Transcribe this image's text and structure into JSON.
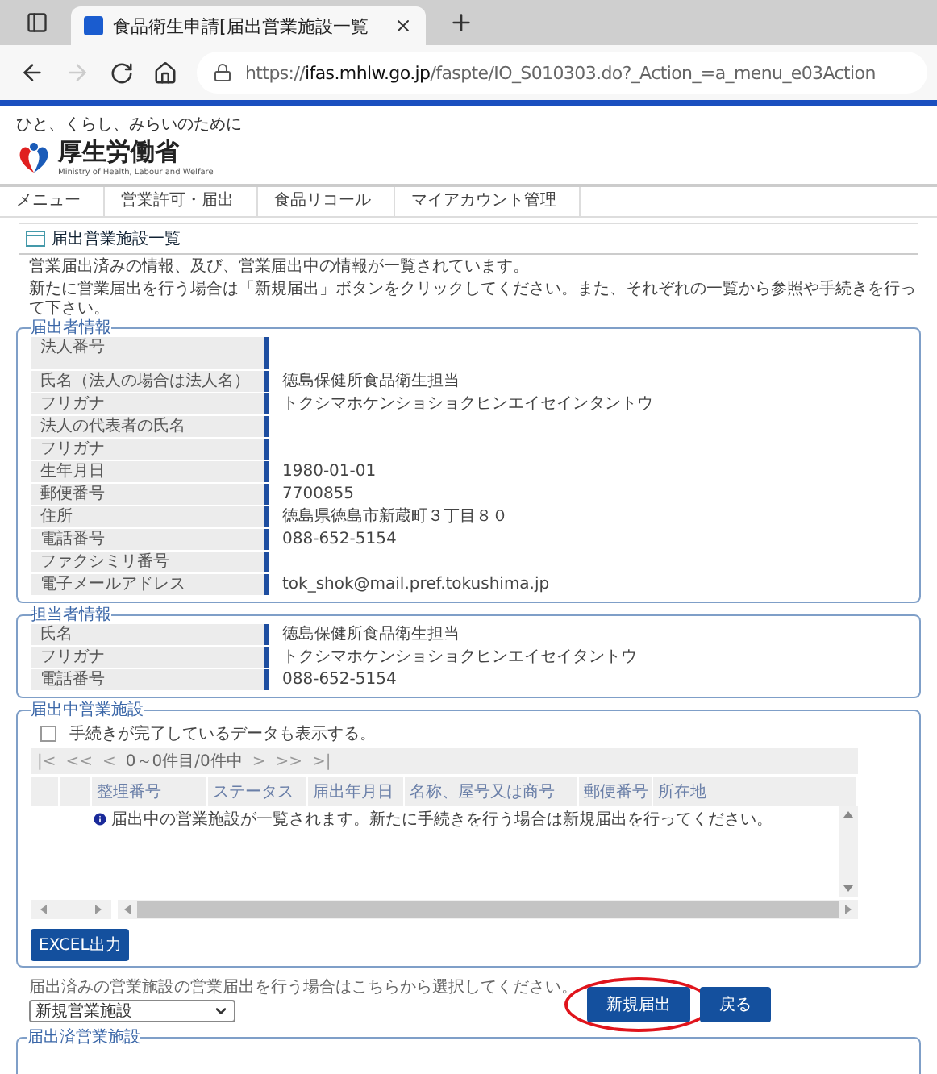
{
  "browser": {
    "tab_title": "食品衛生申請[届出営業施設一覧",
    "forward_disabled": true,
    "url": {
      "scheme": "https://",
      "host": "ifas.mhlw.go.jp",
      "path": "/faspte/IO_S010303.do?_Action_=a_menu_e03Action"
    }
  },
  "header": {
    "tagline": "ひと、くらし、みらいのために",
    "name": "厚生労働省",
    "name_en": "Ministry of Health, Labour and Welfare"
  },
  "nav": [
    "メニュー",
    "営業許可・届出",
    "食品リコール",
    "マイアカウント管理"
  ],
  "page_title": "届出営業施設一覧",
  "intro": [
    "営業届出済みの情報、及び、営業届出中の情報が一覧されています。",
    "新たに営業届出を行う場合は「新規届出」ボタンをクリックしてください。また、それぞれの一覧から参照や手続きを行って下さい。"
  ],
  "applicant": {
    "legend": "届出者情報",
    "rows": [
      {
        "label": "法人番号",
        "value": "",
        "tall": true
      },
      {
        "label": "氏名（法人の場合は法人名）",
        "value": "徳島保健所食品衛生担当"
      },
      {
        "label": "フリガナ",
        "value": "トクシマホケンショショクヒンエイセインタントウ"
      },
      {
        "label": "法人の代表者の氏名",
        "value": ""
      },
      {
        "label": "フリガナ",
        "value": ""
      },
      {
        "label": "生年月日",
        "value": "1980-01-01"
      },
      {
        "label": "郵便番号",
        "value": "7700855"
      },
      {
        "label": "住所",
        "value": "徳島県徳島市新蔵町３丁目８０"
      },
      {
        "label": "電話番号",
        "value": "088-652-5154"
      },
      {
        "label": "ファクシミリ番号",
        "value": ""
      },
      {
        "label": "電子メールアドレス",
        "value": "tok_shok@mail.pref.tokushima.jp"
      }
    ]
  },
  "contact": {
    "legend": "担当者情報",
    "rows": [
      {
        "label": "氏名",
        "value": "徳島保健所食品衛生担当"
      },
      {
        "label": "フリガナ",
        "value": "トクシマホケンショショクヒンエイセイタントウ"
      },
      {
        "label": "電話番号",
        "value": "088-652-5154"
      }
    ]
  },
  "facilities": {
    "legend": "届出中営業施設",
    "show_completed": {
      "label": "手続きが完了しているデータも表示する。",
      "checked": false
    },
    "pager": {
      "first": "|<",
      "prev_page": "<<",
      "prev": "<",
      "status": "0～0件目/0件中",
      "next": ">",
      "next_page": ">>",
      "last": ">|"
    },
    "columns": [
      "整理番号",
      "ステータス",
      "届出年月日",
      "名称、屋号又は商号",
      "郵便番号",
      "所在地"
    ],
    "message": "届出中の営業施設が一覧されます。新たに手続きを行う場合は新規届出を行ってください。"
  },
  "excel_button": "EXCEL出力",
  "footer": {
    "hint": "届出済みの営業施設の営業届出を行う場合はこちらから選択してください。",
    "select_value": "新規営業施設",
    "buttons": [
      {
        "label": "新規届出",
        "circled": true
      },
      {
        "label": "戻る",
        "circled": false
      }
    ]
  },
  "next_legend": "届出済営業施設"
}
